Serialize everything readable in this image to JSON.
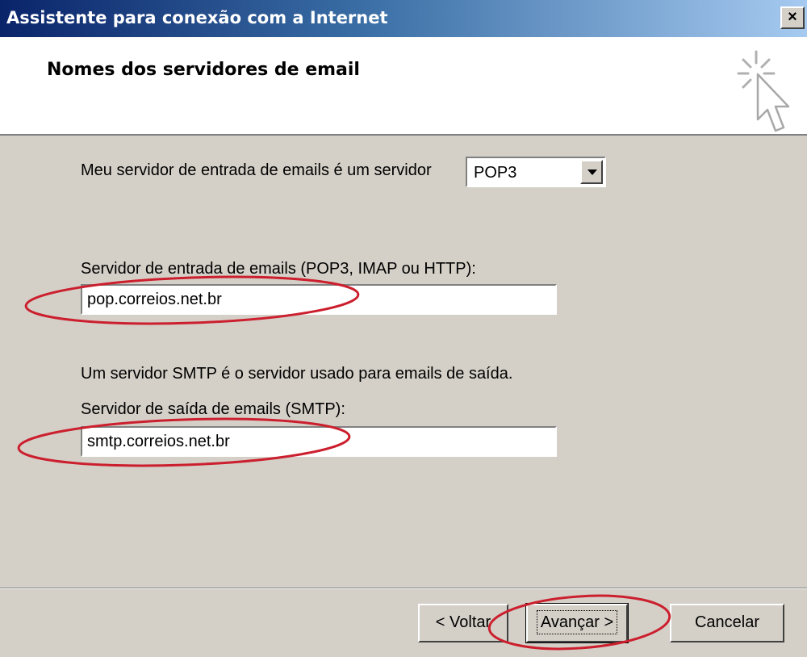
{
  "window": {
    "title": "Assistente para conexão com a Internet",
    "close_glyph": "×"
  },
  "header": {
    "title": "Nomes dos servidores de email",
    "icon": "wizard-cursor-icon"
  },
  "form": {
    "server_type_label": "Meu servidor de entrada de emails é um  servidor",
    "server_type_value": "POP3",
    "incoming_label": "Servidor de entrada de emails (POP3, IMAP ou HTTP):",
    "incoming_value": "pop.correios.net.br",
    "smtp_info": "Um servidor SMTP é o servidor usado para emails de saída.",
    "outgoing_label": "Servidor de saída de emails (SMTP):",
    "outgoing_value": "smtp.correios.net.br"
  },
  "buttons": {
    "back": "< Voltar",
    "next": "Avançar >",
    "cancel": "Cancelar"
  },
  "annotations": {
    "highlight_color": "#cc1f2e"
  }
}
